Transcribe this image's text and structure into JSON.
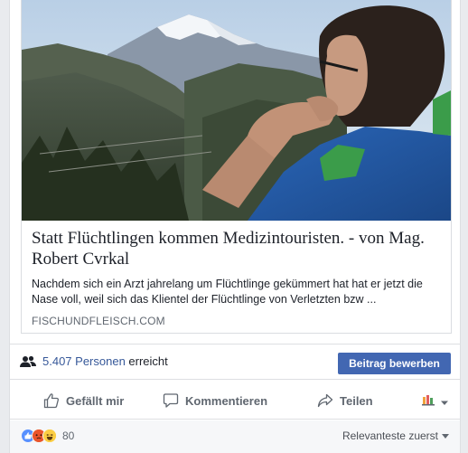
{
  "link": {
    "title": "Statt Flüchtlingen kommen Medizintouristen. - von Mag. Robert Cvrkal",
    "description": "Nachdem sich ein Arzt jahrelang um Flüchtlinge gekümmert hat hat er jetzt die Nase voll, weil sich das Klientel der Flüchtlinge von Verletzten bzw ...",
    "domain": "FISCHUNDFLEISCH.COM"
  },
  "reach": {
    "count": "5.407 Personen",
    "suffix": "erreicht",
    "boost_label": "Beitrag bewerben"
  },
  "actions": {
    "like": "Gefällt mir",
    "comment": "Kommentieren",
    "share": "Teilen"
  },
  "reactions": {
    "types": [
      "like-icon",
      "angry-icon",
      "haha-icon"
    ],
    "count": "80",
    "sort_label": "Relevanteste zuerst"
  },
  "colors": {
    "accent": "#4267b2",
    "link_blue": "#365899",
    "muted": "#606770"
  }
}
